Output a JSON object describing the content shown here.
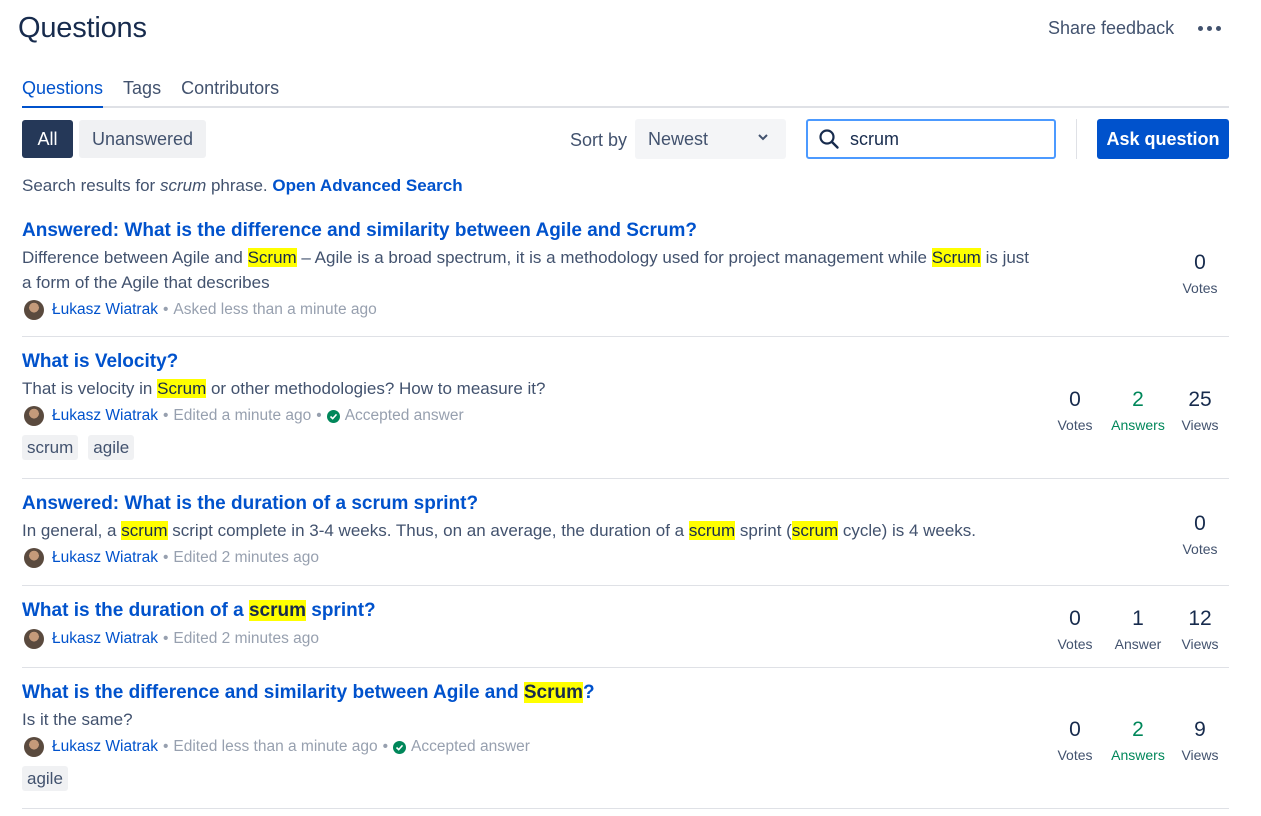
{
  "header": {
    "title": "Questions",
    "share_feedback": "Share feedback",
    "more_icon": "more-horizontal-icon"
  },
  "tabs": [
    {
      "label": "Questions",
      "active": true
    },
    {
      "label": "Tags",
      "active": false
    },
    {
      "label": "Contributors",
      "active": false
    }
  ],
  "filters": {
    "all_label": "All",
    "unanswered_label": "Unanswered",
    "sort_label": "Sort by",
    "sort_value": "Newest"
  },
  "search": {
    "value": "scrum",
    "icon": "search-icon"
  },
  "ask_button": "Ask question",
  "results_info": {
    "prefix": "Search results for ",
    "term": "scrum",
    "suffix": " phrase. ",
    "advanced_link": "Open Advanced Search"
  },
  "colors": {
    "link": "#0052cc",
    "highlight": "#ffff00",
    "accepted": "#00875a",
    "primary_button": "#0052cc",
    "selected_filter": "#253858"
  },
  "questions": [
    {
      "title": "Answered: What is the difference and similarity between Agile and Scrum?",
      "excerpt_parts": [
        "Difference between Agile and ",
        "Scrum",
        " – Agile is a broad spectrum, it is a methodology used for project management while ",
        "Scrum",
        " is just a form of the Agile that describes"
      ],
      "author": "Łukasz Wiatrak",
      "activity": "Asked less than a minute ago",
      "votes": "0",
      "votes_label": "Votes"
    },
    {
      "title": "What is Velocity?",
      "excerpt_parts": [
        "That is velocity in ",
        "Scrum",
        " or other methodologies? How to measure it?"
      ],
      "author": "Łukasz Wiatrak",
      "activity": "Edited a minute ago",
      "accepted": "Accepted answer",
      "tags": [
        "scrum",
        "agile"
      ],
      "votes": "0",
      "votes_label": "Votes",
      "answers": "2",
      "answers_label": "Answers",
      "views": "25",
      "views_label": "Views"
    },
    {
      "title": "Answered: What is the duration of a scrum sprint?",
      "excerpt_parts": [
        "In general, a ",
        "scrum",
        " script complete in 3-4 weeks. Thus, on an average, the duration of a ",
        "scrum",
        " sprint (",
        "scrum",
        " cycle) is 4 weeks."
      ],
      "author": "Łukasz Wiatrak",
      "activity": "Edited 2 minutes ago",
      "votes": "0",
      "votes_label": "Votes"
    },
    {
      "title_parts": [
        "What is the duration of a ",
        "scrum",
        " sprint?"
      ],
      "author": "Łukasz Wiatrak",
      "activity": "Edited 2 minutes ago",
      "votes": "0",
      "votes_label": "Votes",
      "answers": "1",
      "answers_label": "Answer",
      "views": "12",
      "views_label": "Views"
    },
    {
      "title_parts": [
        "What is the difference and similarity between Agile and ",
        "Scrum",
        "?"
      ],
      "excerpt": "Is it the same?",
      "author": "Łukasz Wiatrak",
      "activity": "Edited less than a minute ago",
      "accepted": "Accepted answer",
      "tags": [
        "agile"
      ],
      "votes": "0",
      "votes_label": "Votes",
      "answers": "2",
      "answers_label": "Answers",
      "views": "9",
      "views_label": "Views"
    }
  ]
}
